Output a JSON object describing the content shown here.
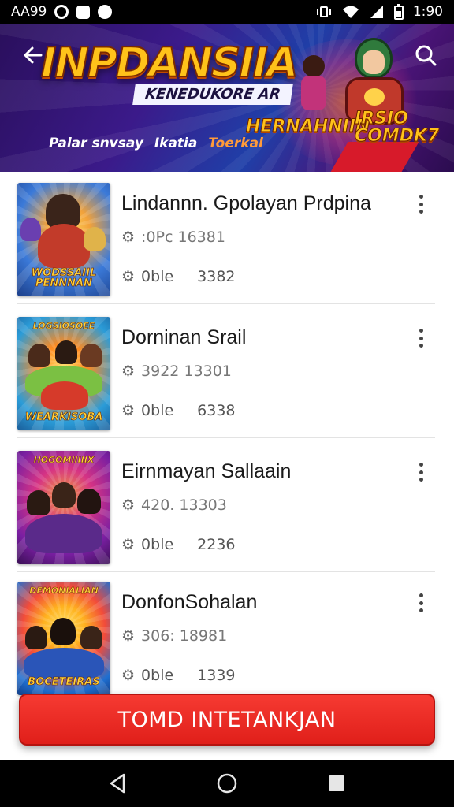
{
  "status_bar": {
    "left_text": "AA99",
    "time": "1:90"
  },
  "banner": {
    "title": "INPDANSIIA",
    "subtitle": "KENEDUKORE AR",
    "tagline": [
      "Palar snvsay",
      "Ikatia",
      "Toerkal"
    ],
    "badge_left": "HERNAHNIIN",
    "badge_right": "IRSIO COMDK7"
  },
  "items": [
    {
      "title": "Lindannn. Gpolayan Prdpina",
      "meta1": ":0Pc 16381",
      "meta2_label": "0ble",
      "meta2_value": "3382",
      "cover_top": "",
      "cover_caption": "WODSSAIIL PENNNAN",
      "cover_colors": [
        "#3b7ad9",
        "#f2a23a",
        "#c23b2a"
      ]
    },
    {
      "title": "Dorninan Srail",
      "meta1": "3922 13301",
      "meta2_label": "0ble",
      "meta2_value": "6338",
      "cover_top": "LOGSIOSOEE",
      "cover_caption": "WEARKISOBA",
      "cover_colors": [
        "#ff8a1f",
        "#2b9cd8",
        "#7bc043"
      ]
    },
    {
      "title": "Eirnmayan Sallaain",
      "meta1": "420. 13303",
      "meta2_label": "0ble",
      "meta2_value": "2236",
      "cover_top": "HOGOMIIIIIX",
      "cover_caption": "",
      "cover_colors": [
        "#7a1fa2",
        "#d63384",
        "#f2a23a"
      ]
    },
    {
      "title": "DonfonSohalan",
      "meta1": "306: 18981",
      "meta2_label": "0ble",
      "meta2_value": "1339",
      "cover_top": "DEMONIALIAN",
      "cover_caption": "BOCETEIRAS",
      "cover_colors": [
        "#1f6fd1",
        "#f24b3a",
        "#ffb21f"
      ]
    }
  ],
  "cta": {
    "label": "TOMD INTETANKJAN"
  },
  "colors": {
    "cta": "#ef2b25",
    "banner_accent": "#ffc21a"
  },
  "icons": {
    "back": "arrow-left-icon",
    "search": "search-icon",
    "meta1": "gear-icon",
    "meta2": "gear-icon",
    "more": "more-vert-icon"
  }
}
